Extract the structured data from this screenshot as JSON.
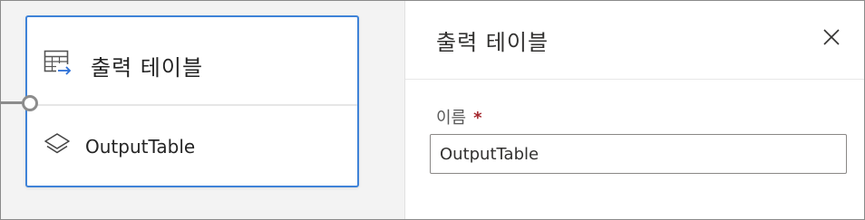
{
  "node": {
    "title": "출력 테이블",
    "name": "OutputTable",
    "header_icon": "table-output-icon",
    "body_icon": "layers-icon"
  },
  "panel": {
    "title": "출력 테이블",
    "close_icon": "close-icon",
    "name_field": {
      "label": "이름",
      "required_marker": "*",
      "value": "OutputTable"
    }
  },
  "colors": {
    "node_border": "#3f83d8",
    "required": "#a4262c",
    "icon_accent": "#2b6fd6"
  }
}
